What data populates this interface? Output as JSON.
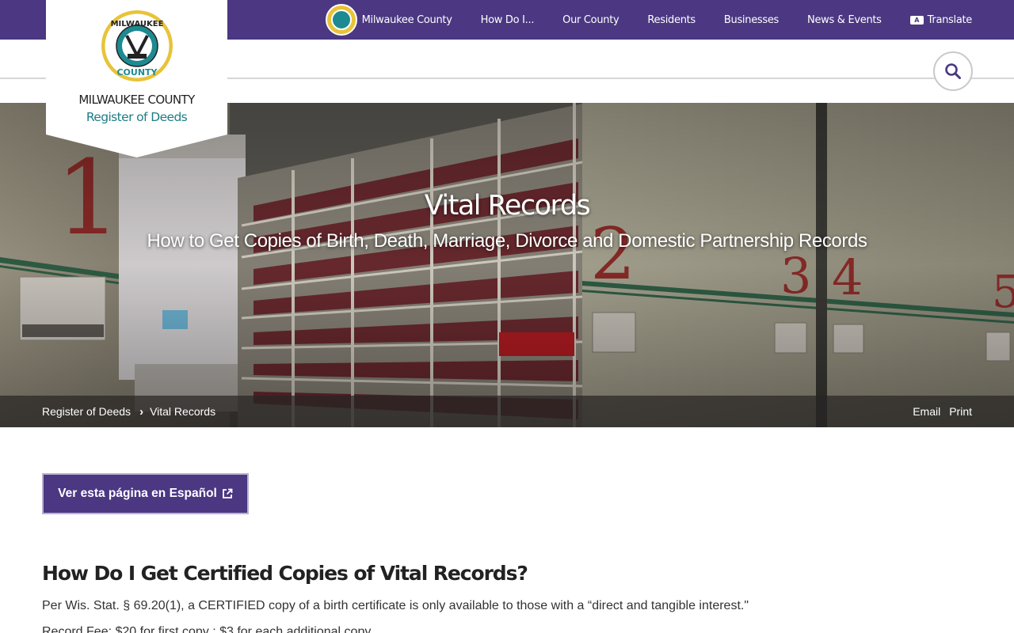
{
  "topnav": {
    "items": [
      {
        "label": "Milwaukee County",
        "icon": "county-seal-icon"
      },
      {
        "label": "How Do I..."
      },
      {
        "label": "Our County"
      },
      {
        "label": "Residents"
      },
      {
        "label": "Businesses"
      },
      {
        "label": "News & Events"
      },
      {
        "label": "Translate",
        "icon": "translate-icon"
      }
    ]
  },
  "logo": {
    "seal_top_text": "MILWAUKEE",
    "seal_bottom_text": "COUNTY",
    "line1": "MILWAUKEE COUNTY",
    "line2": "Register of Deeds"
  },
  "search": {
    "icon": "search-icon"
  },
  "hero": {
    "title": "Vital Records",
    "subtitle": "How to Get Copies of Birth, Death, Marriage, Divorce and Domestic Partnership Records",
    "shelf_numbers": [
      "1",
      "2",
      "3",
      "4",
      "5"
    ]
  },
  "breadcrumb": {
    "items": [
      "Register of Deeds",
      "Vital Records"
    ],
    "actions": [
      "Email",
      "Print"
    ]
  },
  "content": {
    "spanish_button": "Ver esta página en Español",
    "heading": "How Do I Get Certified Copies of Vital Records?",
    "paragraph1": "Per Wis. Stat. § 69.20(1), a CERTIFIED copy of a birth certificate is only available to those with a “direct and tangible interest.\"",
    "paragraph2": "Record Fee: $20 for first copy ; $3 for each additional copy"
  },
  "colors": {
    "brand_purple": "#4b3782",
    "teal": "#1d7d87",
    "gold": "#e8c33a"
  }
}
